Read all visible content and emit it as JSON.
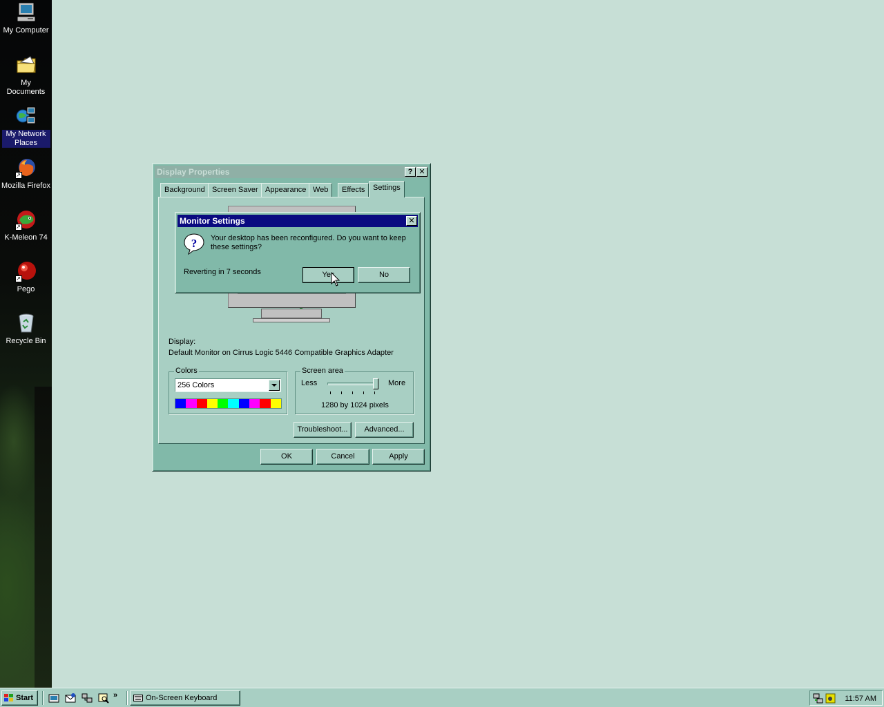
{
  "desktop": {
    "icons": [
      {
        "label": "My Computer"
      },
      {
        "label": "My Documents"
      },
      {
        "label": "My Network Places"
      },
      {
        "label": "Mozilla Firefox"
      },
      {
        "label": "K-Meleon 74"
      },
      {
        "label": "Pego"
      },
      {
        "label": "Recycle Bin"
      }
    ]
  },
  "display_properties": {
    "title": "Display Properties",
    "tabs": [
      {
        "label": "Background"
      },
      {
        "label": "Screen Saver"
      },
      {
        "label": "Appearance"
      },
      {
        "label": "Web"
      },
      {
        "label": "Effects"
      },
      {
        "label": "Settings"
      }
    ],
    "active_tab": "Settings",
    "display_label": "Display:",
    "display_value": "Default Monitor on Cirrus Logic 5446 Compatible Graphics Adapter",
    "colors_group": "Colors",
    "colors_selected": "256 Colors",
    "screen_area_group": "Screen area",
    "slider_less": "Less",
    "slider_more": "More",
    "slider_level": 1.0,
    "resolution_text": "1280 by 1024 pixels",
    "troubleshoot_label": "Troubleshoot...",
    "advanced_label": "Advanced...",
    "ok_label": "OK",
    "cancel_label": "Cancel",
    "apply_label": "Apply",
    "palette_colors": [
      "#0000ff",
      "#ff00ff",
      "#ff0000",
      "#ffff00",
      "#00ff00",
      "#00ffff",
      "#0000ff",
      "#ff00ff",
      "#ff0000",
      "#ffff00"
    ]
  },
  "monitor_settings": {
    "title": "Monitor Settings",
    "message": "Your desktop has been reconfigured.  Do you want to keep these settings?",
    "countdown": "Reverting in 7 seconds",
    "yes_label": "Yes",
    "no_label": "No",
    "icon": "question-icon"
  },
  "taskbar": {
    "start_label": "Start",
    "task_label": "On-Screen Keyboard",
    "clock": "11:57 AM"
  }
}
